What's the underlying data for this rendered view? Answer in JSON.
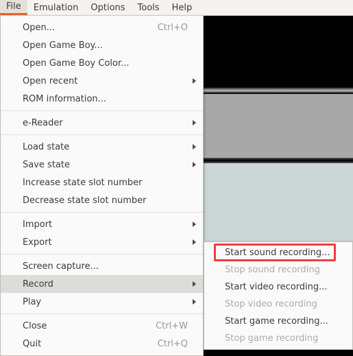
{
  "menubar": {
    "items": [
      {
        "label": "File",
        "active": true
      },
      {
        "label": "Emulation",
        "active": false
      },
      {
        "label": "Options",
        "active": false
      },
      {
        "label": "Tools",
        "active": false
      },
      {
        "label": "Help",
        "active": false
      }
    ]
  },
  "file_menu": {
    "items": [
      {
        "label": "Open...",
        "accel": "Ctrl+O",
        "submenu": false,
        "highlight": false,
        "disabled": false
      },
      {
        "label": "Open Game Boy...",
        "accel": "",
        "submenu": false,
        "highlight": false,
        "disabled": false
      },
      {
        "label": "Open Game Boy Color...",
        "accel": "",
        "submenu": false,
        "highlight": false,
        "disabled": false
      },
      {
        "label": "Open recent",
        "accel": "",
        "submenu": true,
        "highlight": false,
        "disabled": false
      },
      {
        "label": "ROM information...",
        "accel": "",
        "submenu": false,
        "highlight": false,
        "disabled": false
      },
      {
        "separator": true
      },
      {
        "label": "e-Reader",
        "accel": "",
        "submenu": true,
        "highlight": false,
        "disabled": false
      },
      {
        "separator": true
      },
      {
        "label": "Load state",
        "accel": "",
        "submenu": true,
        "highlight": false,
        "disabled": false
      },
      {
        "label": "Save state",
        "accel": "",
        "submenu": true,
        "highlight": false,
        "disabled": false
      },
      {
        "label": "Increase state slot number",
        "accel": "",
        "submenu": false,
        "highlight": false,
        "disabled": false
      },
      {
        "label": "Decrease state slot number",
        "accel": "",
        "submenu": false,
        "highlight": false,
        "disabled": false
      },
      {
        "separator": true
      },
      {
        "label": "Import",
        "accel": "",
        "submenu": true,
        "highlight": false,
        "disabled": false
      },
      {
        "label": "Export",
        "accel": "",
        "submenu": true,
        "highlight": false,
        "disabled": false
      },
      {
        "separator": true
      },
      {
        "label": "Screen capture...",
        "accel": "",
        "submenu": false,
        "highlight": false,
        "disabled": false
      },
      {
        "label": "Record",
        "accel": "",
        "submenu": true,
        "highlight": true,
        "disabled": false
      },
      {
        "label": "Play",
        "accel": "",
        "submenu": true,
        "highlight": false,
        "disabled": false
      },
      {
        "separator": true
      },
      {
        "label": "Close",
        "accel": "Ctrl+W",
        "submenu": false,
        "highlight": false,
        "disabled": false
      },
      {
        "label": "Quit",
        "accel": "Ctrl+Q",
        "submenu": false,
        "highlight": false,
        "disabled": false
      }
    ]
  },
  "record_submenu": {
    "items": [
      {
        "label": "Start sound recording...",
        "disabled": false
      },
      {
        "label": "Stop sound recording",
        "disabled": true
      },
      {
        "label": "Start video recording...",
        "disabled": false
      },
      {
        "label": "Stop video recording",
        "disabled": true
      },
      {
        "label": "Start game recording...",
        "disabled": false
      },
      {
        "label": "Stop game recording",
        "disabled": true
      }
    ]
  },
  "annotation": {
    "target_label": "Start sound recording...",
    "color": "#f23c3c"
  },
  "colors": {
    "accent": "#e8622a",
    "menu_bg": "#fbfafa",
    "menubar_bg": "#f4f3f2",
    "highlight_bg": "#dedcd9",
    "text": "#3c3b37",
    "disabled_text": "#aeaba6",
    "game_band_black": "#000000",
    "game_band_gray": "#a8a8a8",
    "game_band_lightblue": "#cad5d4"
  }
}
